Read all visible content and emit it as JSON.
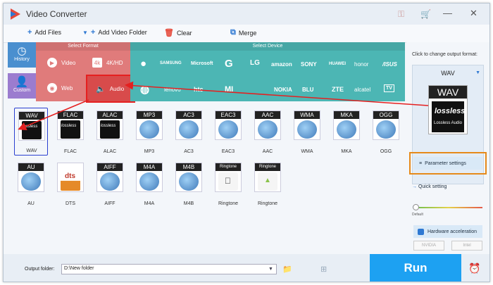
{
  "app": {
    "title": "Video Converter"
  },
  "toolbar": {
    "add_files": "Add Files",
    "add_folder": "Add Video Folder",
    "clear": "Clear",
    "merge": "Merge"
  },
  "sidebar": {
    "history": "History",
    "custom": "Custom"
  },
  "format_panel": {
    "header": "Select Format",
    "video": "Video",
    "hd": "4K/HD",
    "web": "Web",
    "audio": "Audio"
  },
  "device_panel": {
    "header": "Select Device",
    "row1": [
      "SAMSUNG",
      "Microsoft",
      "G",
      "LG",
      "amazon",
      "SONY",
      "HUAWEI",
      "honor",
      "/ISUS"
    ],
    "row2": [
      "lenovo",
      "htc",
      "MI",
      "NOKIA",
      "BLU",
      "ZTE",
      "alcatel",
      "TV"
    ]
  },
  "formats": [
    {
      "tag": "WAV",
      "label": "WAV",
      "art": "lossless",
      "selected": true
    },
    {
      "tag": "FLAC",
      "label": "FLAC",
      "art": "lossless"
    },
    {
      "tag": "ALAC",
      "label": "ALAC",
      "art": "lossless"
    },
    {
      "tag": "MP3",
      "label": "MP3",
      "art": "disc"
    },
    {
      "tag": "AC3",
      "label": "AC3",
      "art": "disc"
    },
    {
      "tag": "EAC3",
      "label": "EAC3",
      "art": "disc"
    },
    {
      "tag": "AAC",
      "label": "AAC",
      "art": "disc"
    },
    {
      "tag": "WMA",
      "label": "WMA",
      "art": "disc"
    },
    {
      "tag": "MKA",
      "label": "MKA",
      "art": "disc"
    },
    {
      "tag": "OGG",
      "label": "OGG",
      "art": "disc"
    },
    {
      "tag": "AU",
      "label": "AU",
      "art": "disc"
    },
    {
      "tag": "",
      "label": "DTS",
      "art": "dts"
    },
    {
      "tag": "AIFF",
      "label": "AIFF",
      "art": "disc"
    },
    {
      "tag": "M4A",
      "label": "M4A",
      "art": "disc"
    },
    {
      "tag": "M4B",
      "label": "M4B",
      "art": "disc"
    },
    {
      "tag": "Ringtone",
      "label": "Ringtone",
      "art": "apple"
    },
    {
      "tag": "Ringtone",
      "label": "Ringtone",
      "art": "android"
    }
  ],
  "right_panel": {
    "hint": "Click to change output format:",
    "format": "WAV",
    "thumb_tag": "WAV",
    "thumb_caption": "Lossless Audio",
    "param_settings": "Parameter settings",
    "quick_setting": "Quick setting",
    "default": "Default",
    "hw_accel": "Hardware acceleration",
    "nvidia": "NVIDIA",
    "intel": "Intel"
  },
  "bottom": {
    "output_label": "Output folder:",
    "output_path": "D:\\New folder",
    "run": "Run"
  },
  "colors": {
    "annotation": "#e52020",
    "selection": "#2a3fd0",
    "highlight": "#e68a1a",
    "run": "#1da1f2"
  }
}
